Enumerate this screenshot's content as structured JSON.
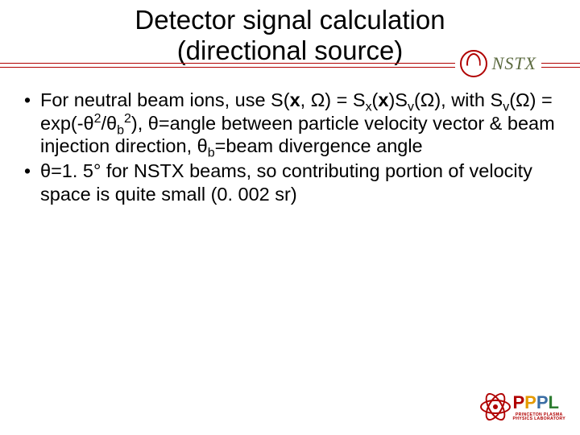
{
  "title": {
    "line1": "Detector signal calculation",
    "line2": "(directional source)"
  },
  "header_brand": {
    "logo_name": "nstx-circle-logo",
    "text": "NSTX"
  },
  "bullets": [
    {
      "html": "For neutral beam ions, use S(<b>x</b>, Ω) = S<sub>x</sub>(<b>x</b>)S<sub>v</sub>(Ω), with S<sub>v</sub>(Ω) = exp(-θ<sup>2</sup>/θ<sub>b</sub><sup>2</sup>), θ=angle between particle velocity vector & beam injection direction, θ<sub>b</sub>=beam divergence angle"
    },
    {
      "html": " θ=1. 5° for NSTX beams, so contributing portion of velocity space is quite small (0. 002 sr)"
    }
  ],
  "footer": {
    "logo_name": "pppl-atom-logo",
    "acronym": "PPPL",
    "subtitle_line1": "PRINCETON PLASMA",
    "subtitle_line2": "PHYSICS LABORATORY"
  }
}
